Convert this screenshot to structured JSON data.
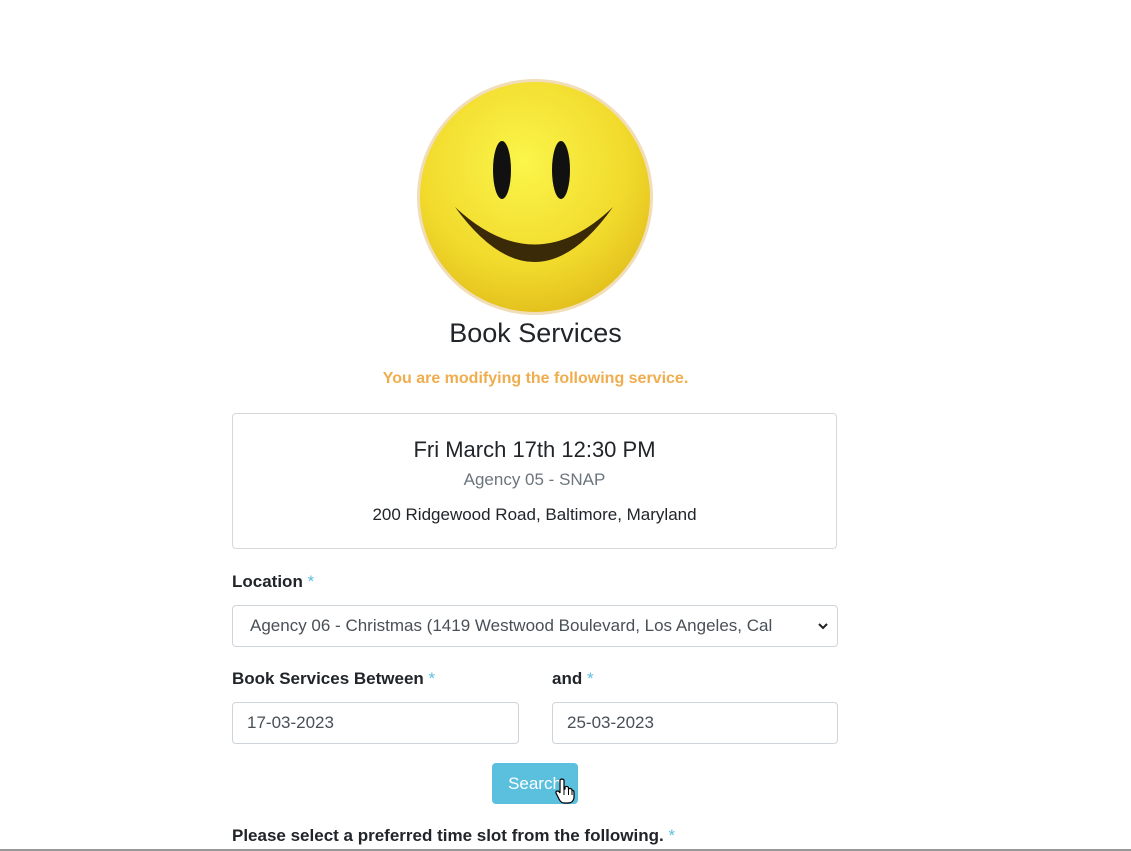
{
  "header": {
    "logo_icon": "smiley-face-icon",
    "title": "Book Services",
    "notice": "You are modifying the following service."
  },
  "current_service": {
    "datetime": "Fri March 17th 12:30 PM",
    "agency": "Agency 05 - SNAP",
    "address": "200 Ridgewood Road, Baltimore, Maryland"
  },
  "form": {
    "location_label": "Location",
    "required_mark": "*",
    "location_value": "Agency 06 - Christmas (1419 Westwood Boulevard, Los Angeles, Cal",
    "between_label": "Book Services Between",
    "and_label": "and",
    "start_date": "17-03-2023",
    "end_date": "25-03-2023",
    "search_label": "Search",
    "timeslot_label": "Please select a preferred time slot from the following."
  },
  "colors": {
    "notice": "#f0ad4e",
    "button": "#5bc0de",
    "required": "#5bc0de"
  }
}
